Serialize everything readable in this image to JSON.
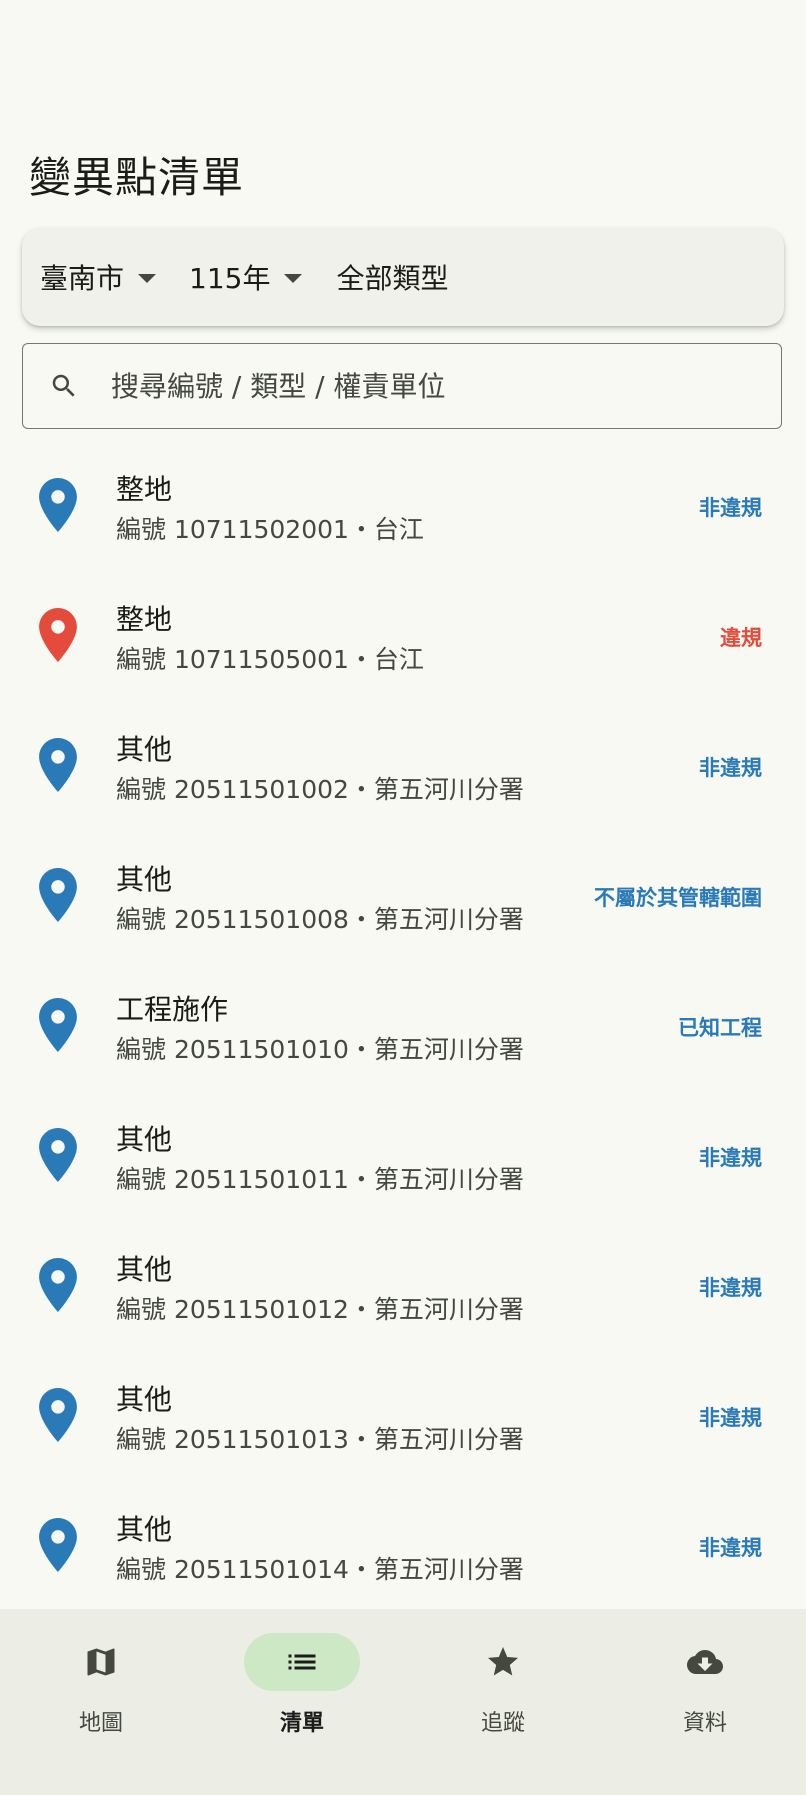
{
  "page_title": "變異點清單",
  "filters": {
    "city": "臺南市",
    "year": "115年",
    "type": "全部類型"
  },
  "search": {
    "placeholder": "搜尋編號 / 類型 / 權責單位",
    "value": ""
  },
  "colors": {
    "blue": "#2a7ab8",
    "red": "#e54b3c",
    "background": "#f7f9f2",
    "nav_indicator": "#cde8c5"
  },
  "items": [
    {
      "title": "整地",
      "subtitle": "編號 10711502001・台江",
      "status": "非違規",
      "pin_color": "#2a7ab8",
      "status_color": "#2a7ab8"
    },
    {
      "title": "整地",
      "subtitle": "編號 10711505001・台江",
      "status": "違規",
      "pin_color": "#e54b3c",
      "status_color": "#e54b3c"
    },
    {
      "title": "其他",
      "subtitle": "編號 20511501002・第五河川分署",
      "status": "非違規",
      "pin_color": "#2a7ab8",
      "status_color": "#2a7ab8"
    },
    {
      "title": "其他",
      "subtitle": "編號 20511501008・第五河川分署",
      "status": "不屬於其管轄範圍",
      "pin_color": "#2a7ab8",
      "status_color": "#2a7ab8"
    },
    {
      "title": "工程施作",
      "subtitle": "編號 20511501010・第五河川分署",
      "status": "已知工程",
      "pin_color": "#2a7ab8",
      "status_color": "#2a7ab8"
    },
    {
      "title": "其他",
      "subtitle": "編號 20511501011・第五河川分署",
      "status": "非違規",
      "pin_color": "#2a7ab8",
      "status_color": "#2a7ab8"
    },
    {
      "title": "其他",
      "subtitle": "編號 20511501012・第五河川分署",
      "status": "非違規",
      "pin_color": "#2a7ab8",
      "status_color": "#2a7ab8"
    },
    {
      "title": "其他",
      "subtitle": "編號 20511501013・第五河川分署",
      "status": "非違規",
      "pin_color": "#2a7ab8",
      "status_color": "#2a7ab8"
    },
    {
      "title": "其他",
      "subtitle": "編號 20511501014・第五河川分署",
      "status": "非違規",
      "pin_color": "#2a7ab8",
      "status_color": "#2a7ab8"
    }
  ],
  "nav": [
    {
      "label": "地圖",
      "icon": "map-icon",
      "active": false
    },
    {
      "label": "清單",
      "icon": "list-icon",
      "active": true
    },
    {
      "label": "追蹤",
      "icon": "star-icon",
      "active": false
    },
    {
      "label": "資料",
      "icon": "cloud-download-icon",
      "active": false
    }
  ]
}
